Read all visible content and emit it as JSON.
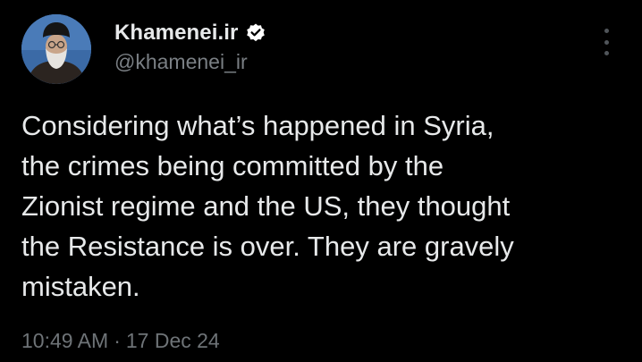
{
  "author": {
    "display_name": "Khamenei.ir",
    "handle": "@khamenei_ir",
    "verified_icon": "verified-badge-icon",
    "avatar": "profile-avatar"
  },
  "tweet": {
    "lines": [
      "Considering what’s happened in Syria,",
      "the crimes being committed by the",
      "Zionist regime and the US, they thought",
      "the Resistance is over. They are gravely",
      "mistaken."
    ],
    "time": "10:49 AM",
    "separator": "·",
    "date": "17 Dec 24"
  },
  "menu": {
    "icon": "more-vertical-icon"
  },
  "colors": {
    "background": "#000000",
    "text": "#e7e9ea",
    "secondary_text": "#7a7f84",
    "verified": "#ffffff"
  }
}
